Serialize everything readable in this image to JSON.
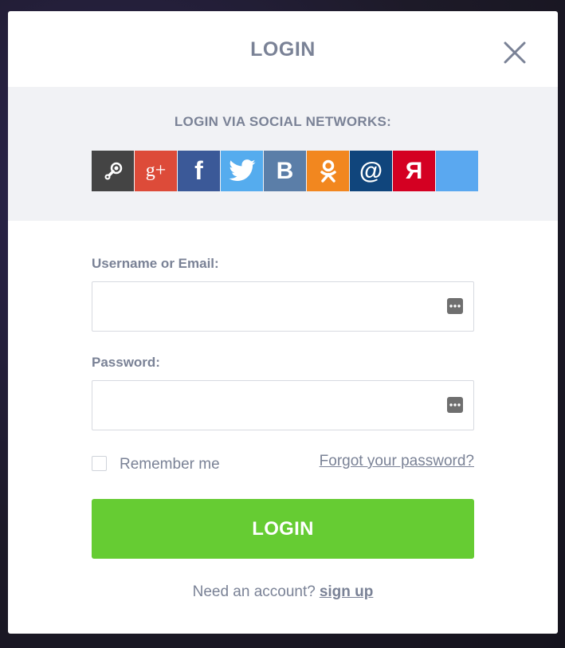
{
  "modal": {
    "title": "LOGIN"
  },
  "social": {
    "heading": "LOGIN VIA SOCIAL NETWORKS:",
    "providers": [
      {
        "name": "steam",
        "icon": "steam-icon",
        "color": "#444444"
      },
      {
        "name": "google-plus",
        "icon": "google-plus-icon",
        "label": "g+",
        "color": "#dd4b39"
      },
      {
        "name": "facebook",
        "icon": "facebook-icon",
        "label": "f",
        "color": "#3b5998"
      },
      {
        "name": "twitter",
        "icon": "twitter-bird-icon",
        "color": "#55acee"
      },
      {
        "name": "vk",
        "icon": "vk-icon",
        "label": "B",
        "color": "#5b7ea8"
      },
      {
        "name": "odnoklassniki",
        "icon": "odnoklassniki-icon",
        "color": "#f2871f"
      },
      {
        "name": "mail-ru",
        "icon": "at-sign-icon",
        "label": "@",
        "color": "#10457c"
      },
      {
        "name": "yandex",
        "icon": "yandex-icon",
        "label": "Я",
        "color": "#d40022"
      },
      {
        "name": "blank",
        "icon": "blank-icon",
        "color": "#5aa8f0"
      }
    ]
  },
  "form": {
    "username_label": "Username or Email:",
    "username_value": "",
    "password_label": "Password:",
    "password_value": "",
    "remember_label": "Remember me",
    "forgot_label": "Forgot your password?",
    "submit_label": "LOGIN",
    "signup_prompt": "Need an account?",
    "signup_label": "sign up"
  },
  "colors": {
    "accent_green": "#66cc33",
    "text_gray": "#7a8296",
    "panel_bg": "#f1f2f5"
  }
}
